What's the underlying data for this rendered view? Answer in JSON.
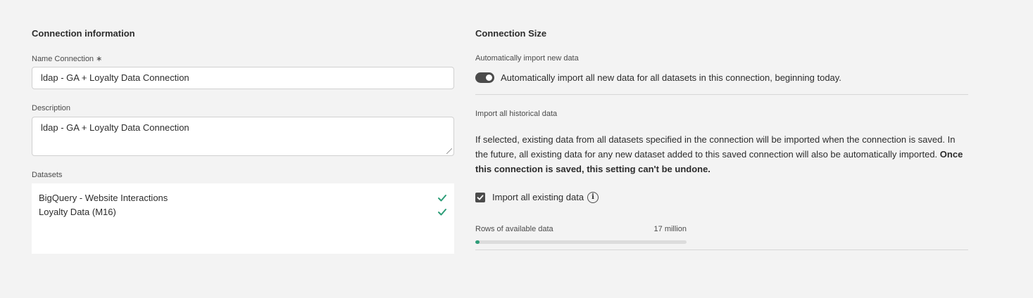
{
  "connection_info": {
    "title": "Connection information",
    "name_label": "Name Connection ∗",
    "name_value": "ldap - GA + Loyalty Data Connection",
    "description_label": "Description",
    "description_value": "ldap - GA + Loyalty Data Connection",
    "datasets_label": "Datasets",
    "datasets": [
      {
        "name": "BigQuery - Website Interactions",
        "icon": "checkmark-icon"
      },
      {
        "name": "Loyalty Data (M16)",
        "icon": "checkmark-icon"
      }
    ]
  },
  "connection_size": {
    "title": "Connection Size",
    "auto_import_label": "Automatically import new data",
    "auto_import_toggle_text": "Automatically import all new data for all datasets in this connection, beginning today.",
    "auto_import_enabled": true,
    "historical_label": "Import all historical data",
    "historical_description": "If selected, existing data from all datasets specified in the connection will be imported when the connection is saved. In the future, all existing data for any new dataset added to this saved connection will also be automatically imported. ",
    "historical_description_bold": "Once this connection is saved, this setting can't be undone.",
    "import_existing_label": "Import all existing data",
    "import_existing_checked": true,
    "rows_label": "Rows of available data",
    "rows_value": "17 million",
    "rows_progress_fraction": 0.02
  },
  "colors": {
    "accent_green": "#2d9d78",
    "control_dark": "#4b4b4b",
    "background": "#f3f3f3"
  }
}
